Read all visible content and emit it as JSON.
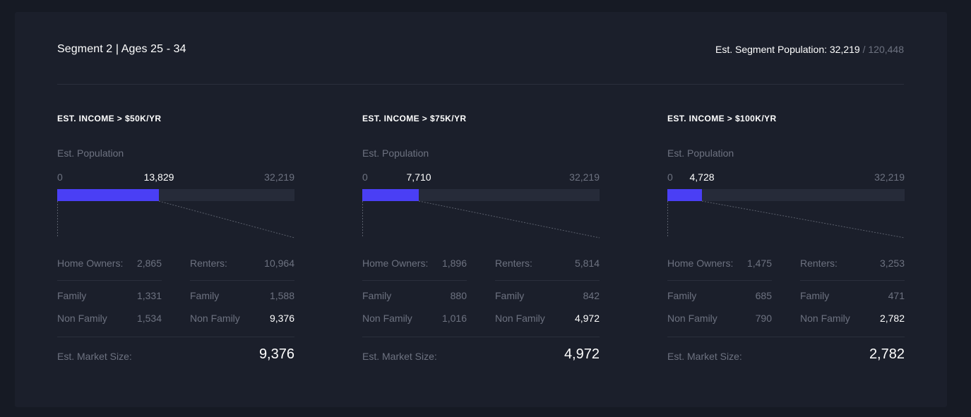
{
  "header": {
    "segment_title": "Segment 2 | Ages 25 - 34",
    "population_label": "Est. Segment Population: 32,219",
    "population_total": "/ 120,448"
  },
  "accent_color": "#4a3ff5",
  "panels": [
    {
      "title": "EST. INCOME > $50K/YR",
      "pop_label": "Est. Population",
      "axis_min": "0",
      "axis_max": "32,219",
      "pop_value": "13,829",
      "fill_fraction": 0.4292,
      "home_owners_label": "Home Owners:",
      "home_owners": "2,865",
      "renters_label": "Renters:",
      "renters": "10,964",
      "owner_family_label": "Family",
      "owner_family": "1,331",
      "owner_nonfamily_label": "Non Family",
      "owner_nonfamily": "1,534",
      "renter_family_label": "Family",
      "renter_family": "1,588",
      "renter_nonfamily_label": "Non Family",
      "renter_nonfamily": "9,376",
      "market_label": "Est. Market Size:",
      "market_size": "9,376"
    },
    {
      "title": "EST. INCOME > $75K/YR",
      "pop_label": "Est. Population",
      "axis_min": "0",
      "axis_max": "32,219",
      "pop_value": "7,710",
      "fill_fraction": 0.2393,
      "home_owners_label": "Home Owners:",
      "home_owners": "1,896",
      "renters_label": "Renters:",
      "renters": "5,814",
      "owner_family_label": "Family",
      "owner_family": "880",
      "owner_nonfamily_label": "Non Family",
      "owner_nonfamily": "1,016",
      "renter_family_label": "Family",
      "renter_family": "842",
      "renter_nonfamily_label": "Non Family",
      "renter_nonfamily": "4,972",
      "market_label": "Est. Market Size:",
      "market_size": "4,972"
    },
    {
      "title": "EST. INCOME > $100K/YR",
      "pop_label": "Est. Population",
      "axis_min": "0",
      "axis_max": "32,219",
      "pop_value": "4,728",
      "fill_fraction": 0.1467,
      "home_owners_label": "Home Owners:",
      "home_owners": "1,475",
      "renters_label": "Renters:",
      "renters": "3,253",
      "owner_family_label": "Family",
      "owner_family": "685",
      "owner_nonfamily_label": "Non Family",
      "owner_nonfamily": "790",
      "renter_family_label": "Family",
      "renter_family": "471",
      "renter_nonfamily_label": "Non Family",
      "renter_nonfamily": "2,782",
      "market_label": "Est. Market Size:",
      "market_size": "2,782"
    }
  ]
}
